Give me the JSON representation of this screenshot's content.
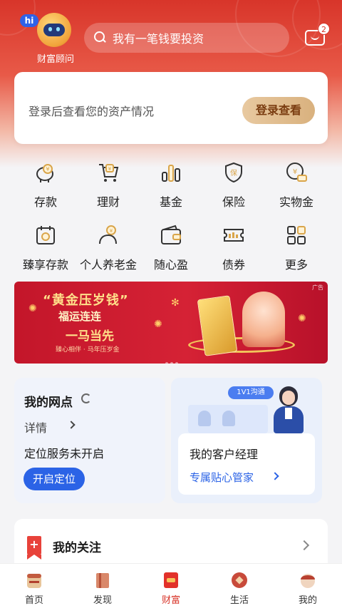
{
  "header": {
    "advisor_badge": "hi",
    "advisor_label": "财富顾问",
    "search_placeholder": "我有一笔钱要投资",
    "message_count": "2"
  },
  "login_card": {
    "tip": "登录后查看您的资产情况",
    "button_label": "登录查看"
  },
  "services": [
    {
      "label": "存款",
      "icon": "piggy-bank-icon"
    },
    {
      "label": "理财",
      "icon": "cart-icon"
    },
    {
      "label": "基金",
      "icon": "bar-chart-icon"
    },
    {
      "label": "保险",
      "icon": "shield-icon"
    },
    {
      "label": "实物金",
      "icon": "gold-icon"
    },
    {
      "label": "臻享存款",
      "icon": "calendar-icon"
    },
    {
      "label": "个人养老金",
      "icon": "elder-icon"
    },
    {
      "label": "随心盈",
      "icon": "wallet-icon"
    },
    {
      "label": "债券",
      "icon": "ticket-icon"
    },
    {
      "label": "更多",
      "icon": "grid-icon"
    }
  ],
  "banner": {
    "line1": "“黄金压岁钱”",
    "line2": "福运连连",
    "line3": "一马当先",
    "line4": "臻心相伴 · 马年压岁金",
    "ad_tag": "广告"
  },
  "branch_card": {
    "title": "我的网点",
    "detail": "详情",
    "status": "定位服务未开启",
    "button": "开启定位"
  },
  "manager_card": {
    "pill": "1V1沟通",
    "title": "我的客户经理",
    "subtitle": "专属贴心管家"
  },
  "follow": {
    "flag": "+",
    "title": "我的关注"
  },
  "tabs": [
    {
      "label": "首页",
      "icon": "home-icon"
    },
    {
      "label": "发现",
      "icon": "discover-icon"
    },
    {
      "label": "财富",
      "icon": "wealth-icon",
      "active": true
    },
    {
      "label": "生活",
      "icon": "life-icon"
    },
    {
      "label": "我的",
      "icon": "profile-icon"
    }
  ],
  "colors": {
    "brand_red": "#d8352a",
    "accent_blue": "#2b63e6",
    "gold_button": "#d9b17e"
  }
}
